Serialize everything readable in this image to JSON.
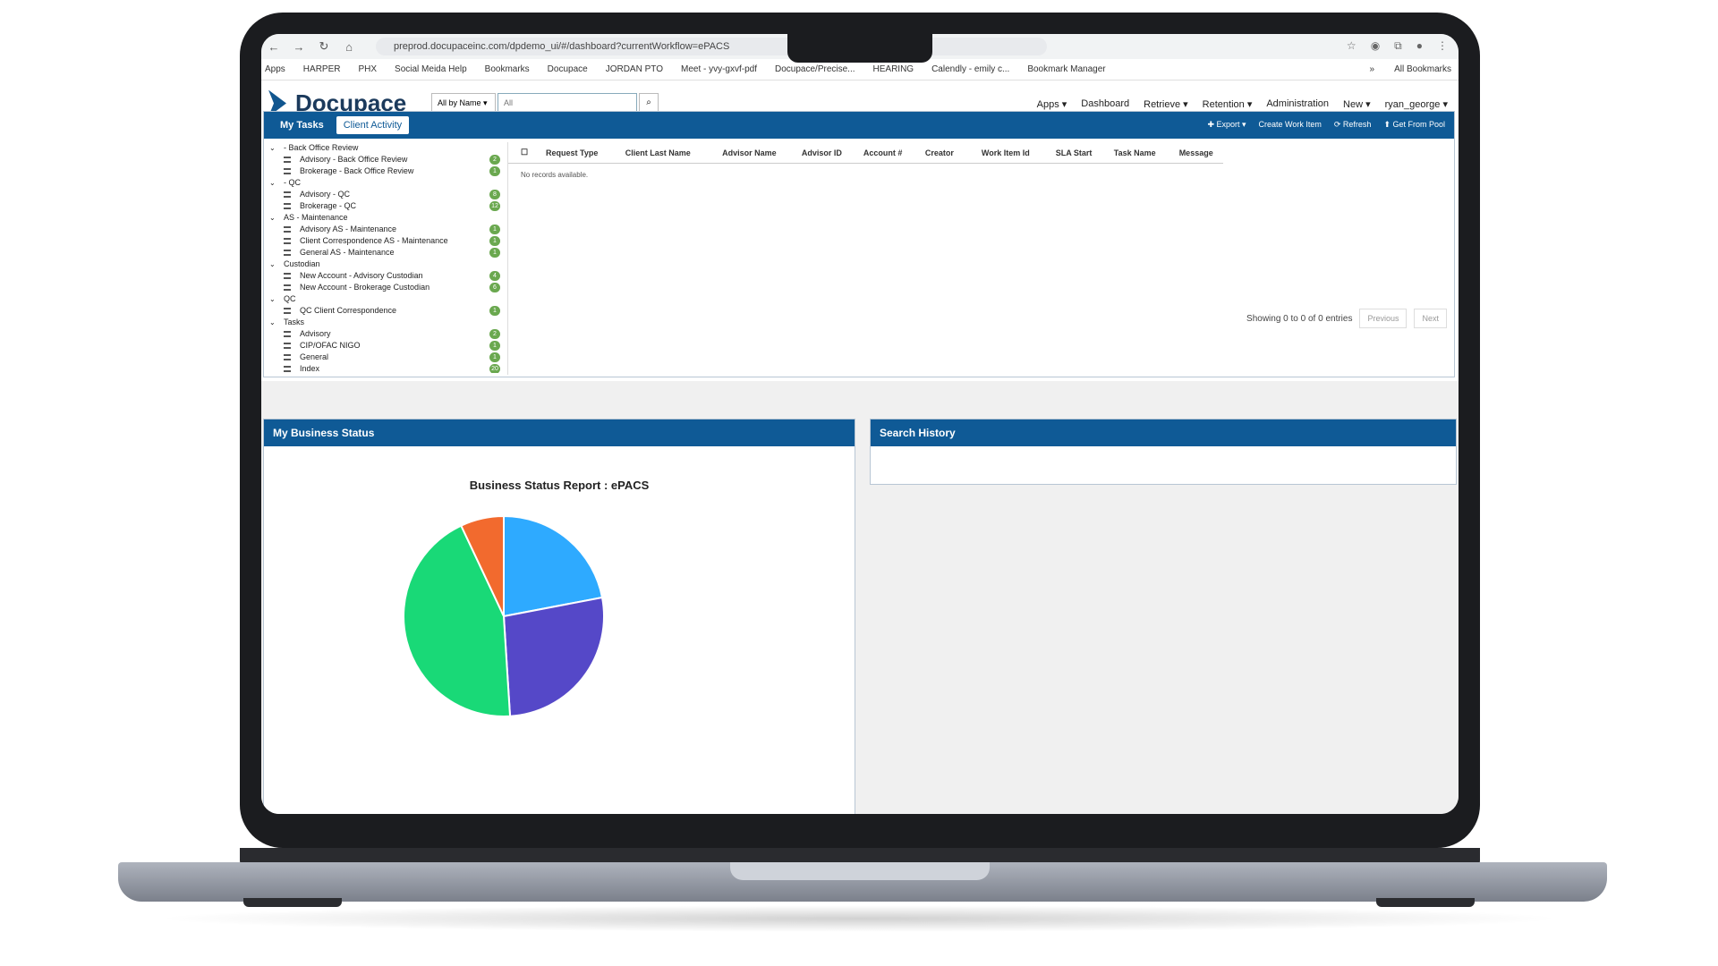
{
  "browser": {
    "url": "preprod.docupaceinc.com/dpdemo_ui/#/dashboard?currentWorkflow=ePACS",
    "bookmarks": [
      "Apps",
      "HARPER",
      "PHX",
      "Social Meida Help",
      "Bookmarks",
      "Docupace",
      "JORDAN PTO",
      "Meet - yvy-gxvf-pdf",
      "Docupace/Precise...",
      "HEARING",
      "Calendly - emily c...",
      "Bookmark Manager"
    ],
    "all_bookmarks": "All Bookmarks",
    "more": "»"
  },
  "app": {
    "logo_text": "Docupace",
    "search_mode": "All by Name ▾",
    "search_placeholder": "All",
    "menu": [
      "Apps ▾",
      "Dashboard",
      "Retrieve ▾",
      "Retention ▾",
      "Administration",
      "New ▾",
      "ryan_george ▾"
    ]
  },
  "tasks": {
    "tab_mytasks": "My Tasks",
    "tab_client": "Client Activity",
    "tools": [
      "✚ Export ▾",
      "Create Work Item",
      "⟳ Refresh",
      "⬆ Get From Pool"
    ],
    "tree": [
      {
        "type": "group",
        "label": "- Back Office Review"
      },
      {
        "type": "leaf",
        "label": "Advisory - Back Office Review",
        "count": "2"
      },
      {
        "type": "leaf",
        "label": "Brokerage - Back Office Review",
        "count": "1"
      },
      {
        "type": "group",
        "label": "- QC"
      },
      {
        "type": "leaf",
        "label": "Advisory - QC",
        "count": "8"
      },
      {
        "type": "leaf",
        "label": "Brokerage - QC",
        "count": "12"
      },
      {
        "type": "group",
        "label": "AS - Maintenance"
      },
      {
        "type": "leaf",
        "label": "Advisory AS - Maintenance",
        "count": "1"
      },
      {
        "type": "leaf",
        "label": "Client Correspondence AS - Maintenance",
        "count": "1"
      },
      {
        "type": "leaf",
        "label": "General AS - Maintenance",
        "count": "1"
      },
      {
        "type": "group",
        "label": "Custodian"
      },
      {
        "type": "leaf",
        "label": "New Account - Advisory Custodian",
        "count": "4"
      },
      {
        "type": "leaf",
        "label": "New Account - Brokerage Custodian",
        "count": "6"
      },
      {
        "type": "group",
        "label": "QC"
      },
      {
        "type": "leaf",
        "label": "QC Client Correspondence",
        "count": "1"
      },
      {
        "type": "group",
        "label": "Tasks"
      },
      {
        "type": "leaf",
        "label": "Advisory",
        "count": "2"
      },
      {
        "type": "leaf",
        "label": "CIP/OFAC NIGO",
        "count": "1"
      },
      {
        "type": "leaf",
        "label": "General",
        "count": "1"
      },
      {
        "type": "leaf",
        "label": "Index",
        "count": "20"
      }
    ],
    "columns": [
      "Request Type",
      "Client Last Name",
      "Advisor Name",
      "Advisor ID",
      "Account #",
      "Creator",
      "Work Item Id",
      "SLA Start",
      "Task Name",
      "Message"
    ],
    "empty_text": "No records available.",
    "showing": "Showing 0 to 0 of 0 entries",
    "prev": "Previous",
    "next": "Next"
  },
  "business": {
    "title": "My Business Status"
  },
  "search_history": {
    "title": "Search History"
  },
  "chart_data": {
    "type": "pie",
    "title": "Business Status Report : ePACS",
    "values": [
      22,
      27,
      44,
      7
    ],
    "colors": [
      "#2eaaff",
      "#5548c8",
      "#19d977",
      "#f26a2e"
    ]
  }
}
